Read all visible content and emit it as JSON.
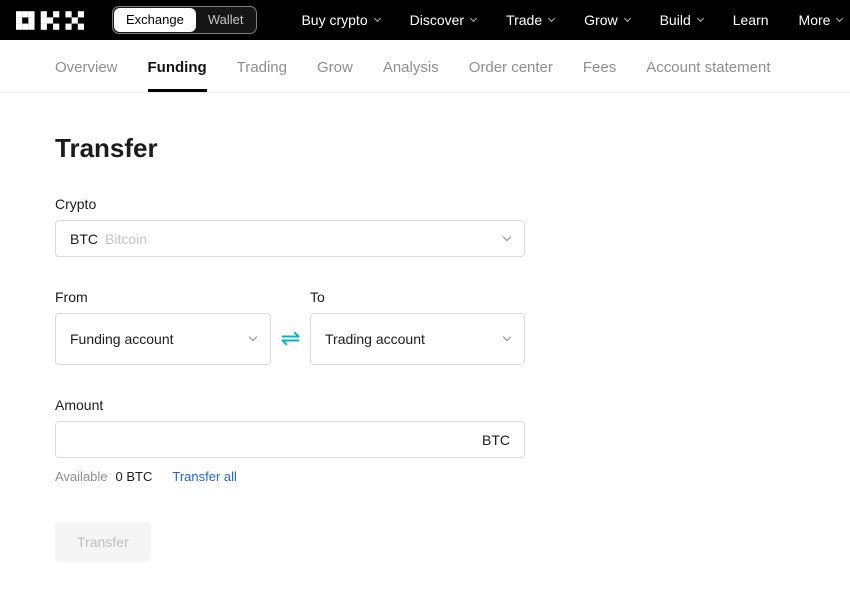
{
  "navbar": {
    "logo_alt": "OKX",
    "exchange_label": "Exchange",
    "wallet_label": "Wallet",
    "items": [
      {
        "label": "Buy crypto"
      },
      {
        "label": "Discover"
      },
      {
        "label": "Trade"
      },
      {
        "label": "Grow"
      },
      {
        "label": "Build"
      },
      {
        "label": "Learn"
      },
      {
        "label": "More"
      }
    ]
  },
  "tabs": [
    {
      "label": "Overview"
    },
    {
      "label": "Funding"
    },
    {
      "label": "Trading"
    },
    {
      "label": "Grow"
    },
    {
      "label": "Analysis"
    },
    {
      "label": "Order center"
    },
    {
      "label": "Fees"
    },
    {
      "label": "Account statement"
    }
  ],
  "main": {
    "title": "Transfer",
    "crypto": {
      "label": "Crypto",
      "symbol": "BTC",
      "name": "Bitcoin"
    },
    "from": {
      "label": "From",
      "value": "Funding account"
    },
    "to": {
      "label": "To",
      "value": "Trading account"
    },
    "amount": {
      "label": "Amount",
      "value": "",
      "unit": "BTC"
    },
    "available": {
      "label": "Available",
      "value": "0 BTC",
      "action": "Transfer all"
    },
    "submit_label": "Transfer"
  },
  "icons": {
    "swap_glyph": "⇌"
  },
  "colors": {
    "accent": "#2264e6",
    "swap": "#00b4c8",
    "active_tab_underline": "#000000"
  }
}
